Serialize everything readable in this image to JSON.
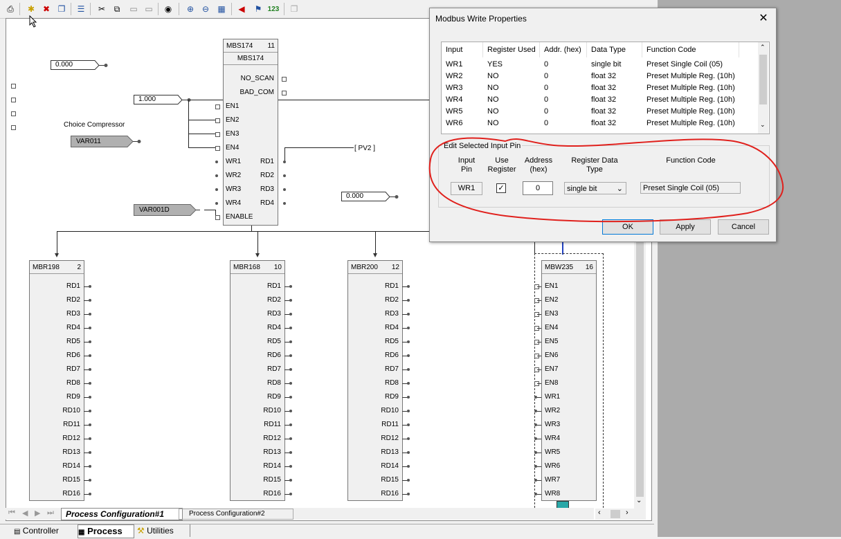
{
  "toolbar": {
    "icons": [
      "print-icon",
      "new-icon",
      "delete-icon",
      "copy-icon",
      "properties-icon",
      "cut-icon",
      "copy2-icon",
      "paste-icon",
      "paste2-icon",
      "find-icon",
      "zoom-in-icon",
      "zoom-out-icon",
      "grid-icon",
      "alarm-icon",
      "flag-icon",
      "numbers-icon",
      "disabled-icon"
    ],
    "numbers_glyph": "123"
  },
  "canvas": {
    "const1": "0.000",
    "const2": "1.000",
    "const3": "0.000",
    "choice_label": "Choice Compressor",
    "var1": "VAR011",
    "var2": "VAR001D",
    "pv2_label": "[ PV2 ]"
  },
  "mbs": {
    "id": "MBS174",
    "num": "11",
    "title": "MBS174",
    "pins_right_top": [
      "NO_SCAN",
      "BAD_COM"
    ],
    "pins_left": [
      "EN1",
      "EN2",
      "EN3",
      "EN4",
      "WR1",
      "WR2",
      "WR3",
      "WR4",
      "ENABLE"
    ],
    "pins_right": [
      "RD1",
      "RD2",
      "RD3",
      "RD4"
    ]
  },
  "mbr_blocks": [
    {
      "id": "MBR198",
      "num": "2"
    },
    {
      "id": "MBR168",
      "num": "10"
    },
    {
      "id": "MBR200",
      "num": "12"
    }
  ],
  "mbr_pins": [
    "RD1",
    "RD2",
    "RD3",
    "RD4",
    "RD5",
    "RD6",
    "RD7",
    "RD8",
    "RD9",
    "RD10",
    "RD11",
    "RD12",
    "RD13",
    "RD14",
    "RD15",
    "RD16"
  ],
  "mbw": {
    "id": "MBW235",
    "num": "16",
    "pins": [
      "EN1",
      "EN2",
      "EN3",
      "EN4",
      "EN5",
      "EN6",
      "EN7",
      "EN8",
      "WR1",
      "WR2",
      "WR3",
      "WR4",
      "WR5",
      "WR6",
      "WR7",
      "WR8"
    ]
  },
  "tabs": {
    "active": "Process Configuration#1",
    "inactive": "Process Configuration#2"
  },
  "bottom": {
    "controller": "Controller",
    "process": "Process",
    "utilities": "Utilities"
  },
  "dialog": {
    "title": "Modbus Write Properties",
    "columns": [
      "Input",
      "Register Used",
      "Addr. (hex)",
      "Data Type",
      "Function Code"
    ],
    "rows": [
      [
        "WR1",
        "YES",
        "0",
        "single bit",
        "Preset Single Coil (05)"
      ],
      [
        "WR2",
        "NO",
        "0",
        "float 32",
        "Preset Multiple Reg. (10h)"
      ],
      [
        "WR3",
        "NO",
        "0",
        "float 32",
        "Preset Multiple Reg. (10h)"
      ],
      [
        "WR4",
        "NO",
        "0",
        "float 32",
        "Preset Multiple Reg. (10h)"
      ],
      [
        "WR5",
        "NO",
        "0",
        "float 32",
        "Preset Multiple Reg. (10h)"
      ],
      [
        "WR6",
        "NO",
        "0",
        "float 32",
        "Preset Multiple Reg. (10h)"
      ]
    ],
    "group_title": "Edit Selected Input Pin",
    "edit_headers": {
      "input_pin": "Input Pin",
      "use_register": "Use Register",
      "address": "Address (hex)",
      "data_type": "Register Data Type",
      "function_code": "Function Code"
    },
    "edit_values": {
      "input_pin": "WR1",
      "use_register_checked": true,
      "address": "0",
      "data_type": "single bit",
      "function_code": "Preset Single Coil (05)"
    },
    "ok": "OK",
    "apply": "Apply",
    "cancel": "Cancel"
  },
  "annotation_color": "#e0201c"
}
